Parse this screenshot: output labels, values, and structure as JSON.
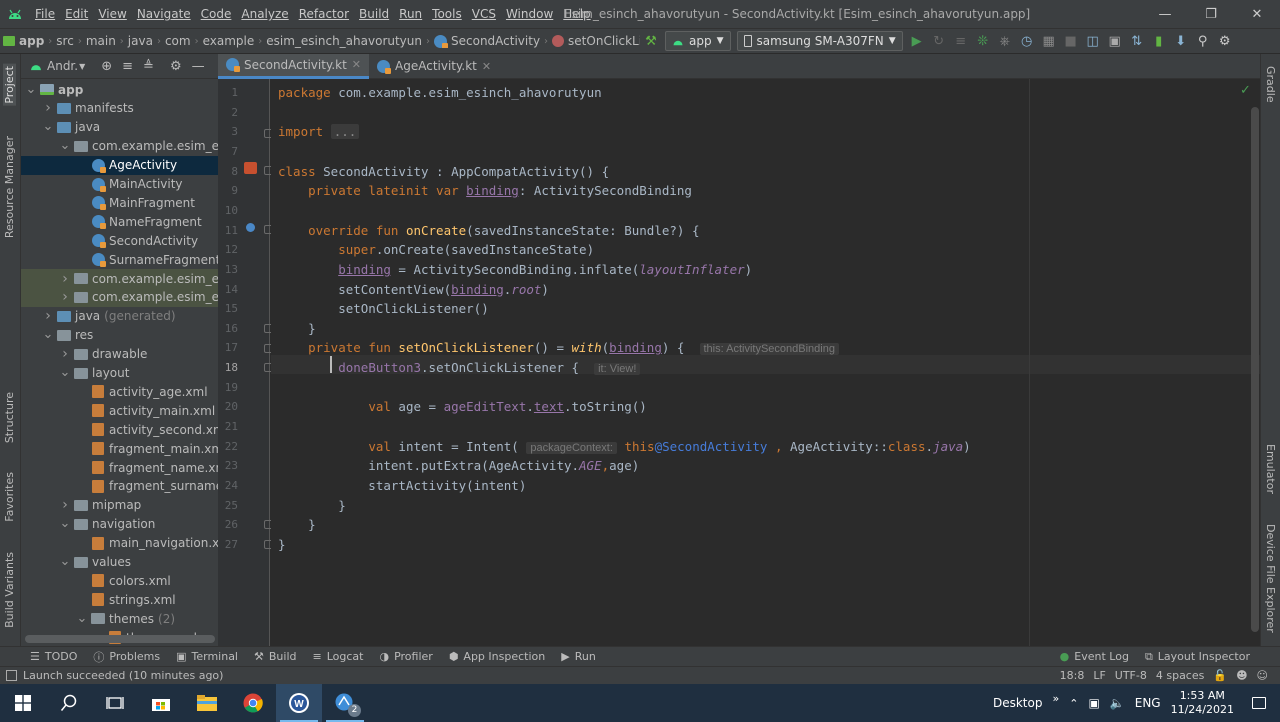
{
  "menubar": {
    "items": [
      "File",
      "Edit",
      "View",
      "Navigate",
      "Code",
      "Analyze",
      "Refactor",
      "Build",
      "Run",
      "Tools",
      "VCS",
      "Window",
      "Help"
    ],
    "window_title": "Esim_esinch_ahavorutyun - SecondActivity.kt [Esim_esinch_ahavorutyun.app]"
  },
  "navbar": {
    "breadcrumbs": [
      "app",
      "src",
      "main",
      "java",
      "com",
      "example",
      "esim_esinch_ahavorutyun",
      "SecondActivity",
      "setOnClickListener()"
    ],
    "run_config": "app",
    "device": "samsung SM-A307FN"
  },
  "sidebar_left": {
    "labels": [
      "Project",
      "Resource Manager",
      "Structure",
      "Favorites",
      "Build Variants"
    ]
  },
  "sidebar_right": {
    "labels": [
      "Gradle",
      "Emulator",
      "Device File Explorer"
    ]
  },
  "project_panel": {
    "view_selector": "Andr.",
    "tree": [
      {
        "label": "app",
        "depth": 0,
        "icon": "module",
        "arrow": "open",
        "bold": true
      },
      {
        "label": "manifests",
        "depth": 1,
        "icon": "folder-blue",
        "arrow": "closed"
      },
      {
        "label": "java",
        "depth": 1,
        "icon": "folder-blue",
        "arrow": "open"
      },
      {
        "label": "com.example.esim_esinch",
        "depth": 2,
        "icon": "folder",
        "arrow": "open"
      },
      {
        "label": "AgeActivity",
        "depth": 3,
        "icon": "kotlin",
        "arrow": "none",
        "selected": true
      },
      {
        "label": "MainActivity",
        "depth": 3,
        "icon": "kotlin",
        "arrow": "none"
      },
      {
        "label": "MainFragment",
        "depth": 3,
        "icon": "kotlin",
        "arrow": "none"
      },
      {
        "label": "NameFragment",
        "depth": 3,
        "icon": "kotlin",
        "arrow": "none"
      },
      {
        "label": "SecondActivity",
        "depth": 3,
        "icon": "kotlin",
        "arrow": "none"
      },
      {
        "label": "SurnameFragment",
        "depth": 3,
        "icon": "kotlin",
        "arrow": "none"
      },
      {
        "label": "com.example.esim_esinch",
        "depth": 2,
        "icon": "folder",
        "arrow": "closed",
        "highlight": true
      },
      {
        "label": "com.example.esim_esinch",
        "depth": 2,
        "icon": "folder",
        "arrow": "closed",
        "highlight": true
      },
      {
        "label": "java",
        "suffix": "(generated)",
        "depth": 1,
        "icon": "folder-blue",
        "arrow": "closed"
      },
      {
        "label": "res",
        "depth": 1,
        "icon": "folder",
        "arrow": "open"
      },
      {
        "label": "drawable",
        "depth": 2,
        "icon": "folder",
        "arrow": "closed"
      },
      {
        "label": "layout",
        "depth": 2,
        "icon": "folder",
        "arrow": "open"
      },
      {
        "label": "activity_age.xml",
        "depth": 3,
        "icon": "xml",
        "arrow": "none"
      },
      {
        "label": "activity_main.xml",
        "depth": 3,
        "icon": "xml",
        "arrow": "none"
      },
      {
        "label": "activity_second.xml",
        "depth": 3,
        "icon": "xml",
        "arrow": "none"
      },
      {
        "label": "fragment_main.xml",
        "depth": 3,
        "icon": "xml",
        "arrow": "none"
      },
      {
        "label": "fragment_name.xml",
        "depth": 3,
        "icon": "xml",
        "arrow": "none"
      },
      {
        "label": "fragment_surname.xm",
        "depth": 3,
        "icon": "xml",
        "arrow": "none"
      },
      {
        "label": "mipmap",
        "depth": 2,
        "icon": "folder",
        "arrow": "closed"
      },
      {
        "label": "navigation",
        "depth": 2,
        "icon": "folder",
        "arrow": "open"
      },
      {
        "label": "main_navigation.xml",
        "depth": 3,
        "icon": "xml",
        "arrow": "none"
      },
      {
        "label": "values",
        "depth": 2,
        "icon": "folder",
        "arrow": "open"
      },
      {
        "label": "colors.xml",
        "depth": 3,
        "icon": "xml",
        "arrow": "none"
      },
      {
        "label": "strings.xml",
        "depth": 3,
        "icon": "xml",
        "arrow": "none"
      },
      {
        "label": "themes",
        "suffix": "(2)",
        "depth": 3,
        "icon": "folder",
        "arrow": "open"
      },
      {
        "label": "themes.xml",
        "depth": 4,
        "icon": "xml",
        "arrow": "none"
      }
    ]
  },
  "tabs": [
    {
      "label": "SecondActivity.kt",
      "active": true
    },
    {
      "label": "AgeActivity.kt",
      "active": false
    }
  ],
  "editor": {
    "current_line": "18",
    "lines": [
      {
        "n": "1",
        "s": [
          [
            "kw",
            "package "
          ],
          [
            "",
            "com.example.esim_esinch_ahavorutyun"
          ]
        ]
      },
      {
        "n": "2",
        "s": []
      },
      {
        "n": "3",
        "s": [
          [
            "kw",
            "import "
          ],
          [
            "fold",
            "..."
          ]
        ]
      },
      {
        "n": "7",
        "s": []
      },
      {
        "n": "8",
        "s": [
          [
            "kw",
            "class "
          ],
          [
            "",
            "SecondActivity : AppCompatActivity() {"
          ]
        ]
      },
      {
        "n": "9",
        "s": [
          [
            "",
            "    "
          ],
          [
            "kw",
            "private lateinit var "
          ],
          [
            "prop ul",
            "binding"
          ],
          [
            "",
            ": ActivitySecondBinding"
          ]
        ]
      },
      {
        "n": "10",
        "s": []
      },
      {
        "n": "11",
        "s": [
          [
            "",
            "    "
          ],
          [
            "kw",
            "override fun "
          ],
          [
            "fn",
            "onCreate"
          ],
          [
            "",
            "(savedInstanceState: Bundle?) {"
          ]
        ]
      },
      {
        "n": "12",
        "s": [
          [
            "",
            "        "
          ],
          [
            "kw",
            "super"
          ],
          [
            "",
            ".onCreate(savedInstanceState)"
          ]
        ]
      },
      {
        "n": "13",
        "s": [
          [
            "",
            "        "
          ],
          [
            "prop ul",
            "binding"
          ],
          [
            "",
            " = ActivitySecondBinding.inflate("
          ],
          [
            "prop it",
            "layoutInflater"
          ],
          [
            "",
            ")"
          ]
        ]
      },
      {
        "n": "14",
        "s": [
          [
            "",
            "        setContentView("
          ],
          [
            "prop ul",
            "binding"
          ],
          [
            "",
            "."
          ],
          [
            "prop it",
            "root"
          ],
          [
            "",
            ")"
          ]
        ]
      },
      {
        "n": "15",
        "s": [
          [
            "",
            "        setOnClickListener()"
          ]
        ]
      },
      {
        "n": "16",
        "s": [
          [
            "",
            "    }"
          ]
        ]
      },
      {
        "n": "17",
        "s": [
          [
            "",
            "    "
          ],
          [
            "kw",
            "private fun "
          ],
          [
            "fn",
            "setOnClickListener"
          ],
          [
            "",
            "() = "
          ],
          [
            "fn it",
            "with"
          ],
          [
            "",
            "("
          ],
          [
            "prop ul",
            "binding"
          ],
          [
            "",
            ") {  "
          ],
          [
            "hint",
            "this: ActivitySecondBinding"
          ]
        ]
      },
      {
        "n": "18",
        "s": [
          [
            "",
            "        "
          ],
          [
            "prop",
            "doneButton3"
          ],
          [
            "",
            ".setOnClickListener {  "
          ],
          [
            "hint",
            "it: View!"
          ]
        ]
      },
      {
        "n": "19",
        "s": []
      },
      {
        "n": "20",
        "s": [
          [
            "",
            "            "
          ],
          [
            "kw",
            "val "
          ],
          [
            "",
            "age = "
          ],
          [
            "prop",
            "ageEditText"
          ],
          [
            "",
            "."
          ],
          [
            "prop ul",
            "text"
          ],
          [
            "",
            ".toString()"
          ]
        ]
      },
      {
        "n": "21",
        "s": []
      },
      {
        "n": "22",
        "s": [
          [
            "",
            "            "
          ],
          [
            "kw",
            "val "
          ],
          [
            "",
            "intent = Intent( "
          ],
          [
            "hint",
            "packageContext:"
          ],
          [
            "kw",
            " this"
          ],
          [
            "lbl",
            "@SecondActivity"
          ],
          [
            "kw",
            " , "
          ],
          [
            "",
            "AgeActivity::"
          ],
          [
            "kw",
            "class"
          ],
          [
            "",
            "."
          ],
          [
            "prop it",
            "java"
          ],
          [
            "",
            ")"
          ]
        ]
      },
      {
        "n": "23",
        "s": [
          [
            "",
            "            intent.putExtra(AgeActivity."
          ],
          [
            "prop it",
            "AGE"
          ],
          [
            "kw",
            ","
          ],
          [
            "",
            "age)"
          ]
        ]
      },
      {
        "n": "24",
        "s": [
          [
            "",
            "            startActivity(intent)"
          ]
        ]
      },
      {
        "n": "25",
        "s": [
          [
            "",
            "        }"
          ]
        ]
      },
      {
        "n": "26",
        "s": [
          [
            "",
            "    }"
          ]
        ]
      },
      {
        "n": "27",
        "s": [
          [
            "",
            "}"
          ]
        ]
      }
    ]
  },
  "tool_windows_left": [
    {
      "label": "TODO",
      "icon": "list-icon"
    },
    {
      "label": "Problems",
      "icon": "problems-icon"
    },
    {
      "label": "Terminal",
      "icon": "terminal-icon"
    },
    {
      "label": "Build",
      "icon": "hammer-icon"
    },
    {
      "label": "Logcat",
      "icon": "logcat-icon"
    },
    {
      "label": "Profiler",
      "icon": "profiler-icon"
    },
    {
      "label": "App Inspection",
      "icon": "inspection-icon"
    },
    {
      "label": "Run",
      "icon": "run-icon"
    }
  ],
  "tool_windows_right": [
    {
      "label": "Event Log",
      "icon": "event-log-icon"
    },
    {
      "label": "Layout Inspector",
      "icon": "layout-inspector-icon"
    }
  ],
  "status": {
    "message": "Launch succeeded (10 minutes ago)",
    "position": "18:8",
    "line_sep": "LF",
    "encoding": "UTF-8",
    "indent": "4 spaces"
  },
  "taskbar": {
    "desktop_label": "Desktop",
    "language": "ENG",
    "time": "1:53 AM",
    "date": "11/24/2021",
    "badge": "2"
  },
  "colors": {
    "accent": "#4a88c7",
    "keyword": "#cc7832",
    "function": "#ffc66d",
    "property": "#9876aa",
    "text": "#a9b7c6"
  }
}
